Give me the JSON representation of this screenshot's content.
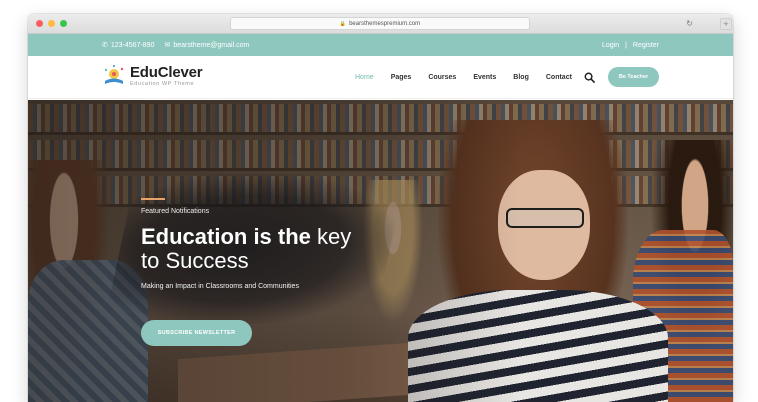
{
  "browser": {
    "url": "bearsthemespremium.com"
  },
  "topbar": {
    "phone": "123-4567-890",
    "email": "bearstheme@gmail.com",
    "login": "Login",
    "separator": "|",
    "register": "Register"
  },
  "brand": {
    "name": "EduClever",
    "tagline": "Education WP Theme"
  },
  "nav": {
    "items": [
      {
        "label": "Home",
        "active": true
      },
      {
        "label": "Pages",
        "active": false
      },
      {
        "label": "Courses",
        "active": false
      },
      {
        "label": "Events",
        "active": false
      },
      {
        "label": "Blog",
        "active": false
      },
      {
        "label": "Contact",
        "active": false
      }
    ],
    "cta": "Be Teacher"
  },
  "hero": {
    "kicker": "Featured Notifications",
    "headline_bold": "Education is the",
    "headline_light": "key",
    "headline_line2": "to Success",
    "subline": "Making an Impact in Classrooms and Communities",
    "button": "SUBSCRIBE NEWSLETTER"
  },
  "colors": {
    "accent": "#8ec7be",
    "active_nav": "#6cbcb0",
    "line_accent": "#e7a46a"
  },
  "icons": [
    "lock-icon",
    "reload-icon",
    "phone-icon",
    "mail-icon",
    "search-icon",
    "logo-icon"
  ]
}
